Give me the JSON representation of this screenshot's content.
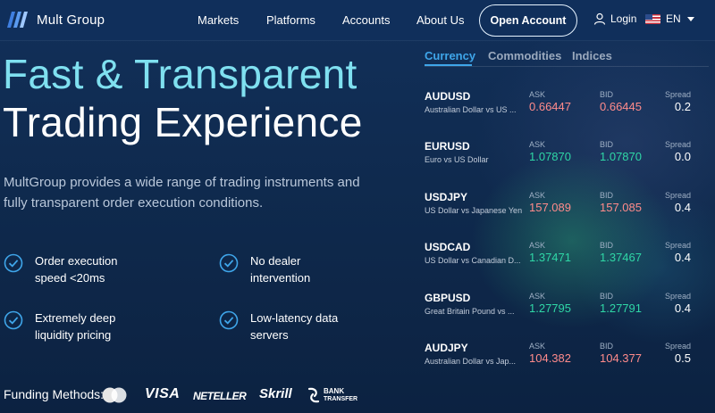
{
  "brand": {
    "name": "Mult Group"
  },
  "nav": {
    "items": [
      "Markets",
      "Platforms",
      "Accounts",
      "About Us"
    ],
    "open_account": "Open Account",
    "login": "Login",
    "language": "EN"
  },
  "hero": {
    "title_line1": "Fast & Transparent",
    "title_line2": "Trading Experience",
    "description": "MultGroup provides a wide range of trading instruments and fully transparent order execution conditions."
  },
  "features": [
    "Order execution speed <20ms",
    "No dealer intervention",
    "Extremely deep liquidity pricing",
    "Low-latency data servers"
  ],
  "funding": {
    "label": "Funding Methods:",
    "methods": [
      "VISA",
      "NETELLER",
      "Skrill",
      "BANK",
      "TRANSFER"
    ]
  },
  "quotes": {
    "tabs": [
      "Currency",
      "Commodities",
      "Indices"
    ],
    "active_tab": "Currency",
    "ask_label": "ASK",
    "bid_label": "BID",
    "spread_label": "Spread",
    "rows": [
      {
        "symbol": "AUDUSD",
        "name": "Australian Dollar vs US ...",
        "ask": "0.66447",
        "bid": "0.66445",
        "spread": "0.2",
        "direction": "down"
      },
      {
        "symbol": "EURUSD",
        "name": "Euro vs US Dollar",
        "ask": "1.07870",
        "bid": "1.07870",
        "spread": "0.0",
        "direction": "up"
      },
      {
        "symbol": "USDJPY",
        "name": "US Dollar vs Japanese Yen",
        "ask": "157.089",
        "bid": "157.085",
        "spread": "0.4",
        "direction": "down"
      },
      {
        "symbol": "USDCAD",
        "name": "US Dollar vs Canadian D...",
        "ask": "1.37471",
        "bid": "1.37467",
        "spread": "0.4",
        "direction": "up"
      },
      {
        "symbol": "GBPUSD",
        "name": "Great Britain Pound vs ...",
        "ask": "1.27795",
        "bid": "1.27791",
        "spread": "0.4",
        "direction": "up"
      },
      {
        "symbol": "AUDJPY",
        "name": "Australian Dollar vs Jap...",
        "ask": "104.382",
        "bid": "104.377",
        "spread": "0.5",
        "direction": "down"
      }
    ]
  },
  "colors": {
    "accent": "#3fa6ea",
    "hero_cyan": "#7fe0f0",
    "up": "#2fd7a6",
    "down": "#ff8b8b"
  }
}
